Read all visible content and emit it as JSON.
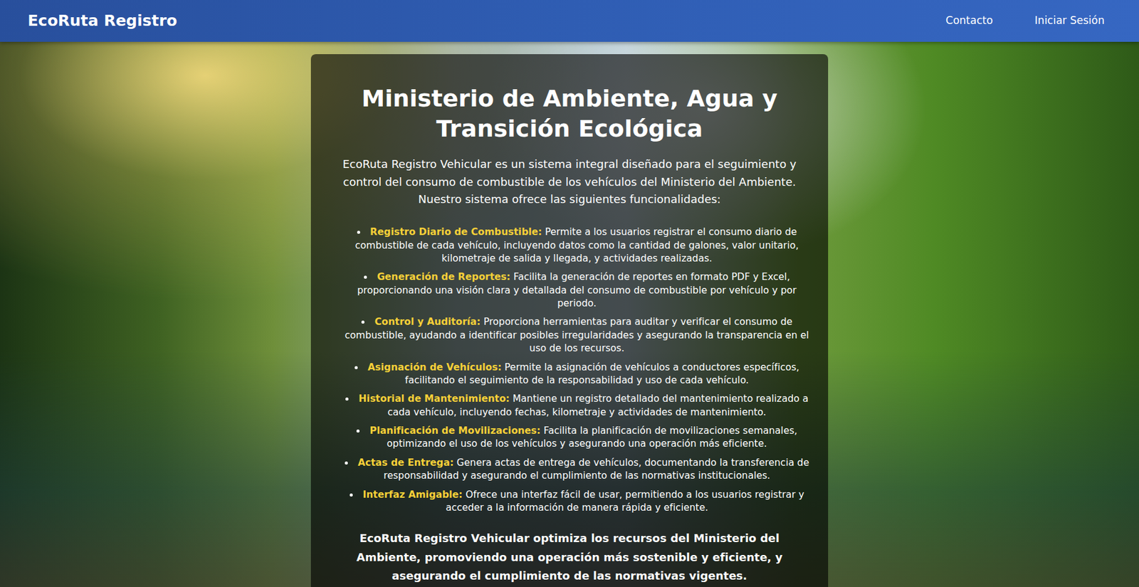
{
  "navbar": {
    "brand": "EcoRuta Registro",
    "links": [
      "Contacto",
      "Iniciar Sesión"
    ]
  },
  "panel": {
    "title": "Ministerio de Ambiente, Agua y Transición Ecológica",
    "intro": "EcoRuta Registro Vehicular es un sistema integral diseñado para el seguimiento y control del consumo de combustible de los vehículos del Ministerio del Ambiente. Nuestro sistema ofrece las siguientes funcionalidades:",
    "features": [
      {
        "label": "Registro Diario de Combustible:",
        "text": "Permite a los usuarios registrar el consumo diario de combustible de cada vehículo, incluyendo datos como la cantidad de galones, valor unitario, kilometraje de salida y llegada, y actividades realizadas."
      },
      {
        "label": "Generación de Reportes:",
        "text": "Facilita la generación de reportes en formato PDF y Excel, proporcionando una visión clara y detallada del consumo de combustible por vehículo y por periodo."
      },
      {
        "label": "Control y Auditoría:",
        "text": "Proporciona herramientas para auditar y verificar el consumo de combustible, ayudando a identificar posibles irregularidades y asegurando la transparencia en el uso de los recursos."
      },
      {
        "label": "Asignación de Vehículos:",
        "text": "Permite la asignación de vehículos a conductores específicos, facilitando el seguimiento de la responsabilidad y uso de cada vehículo."
      },
      {
        "label": "Historial de Mantenimiento:",
        "text": "Mantiene un registro detallado del mantenimiento realizado a cada vehículo, incluyendo fechas, kilometraje y actividades de mantenimiento."
      },
      {
        "label": "Planificación de Movilizaciones:",
        "text": "Facilita la planificación de movilizaciones semanales, optimizando el uso de los vehículos y asegurando una operación más eficiente."
      },
      {
        "label": "Actas de Entrega:",
        "text": "Genera actas de entrega de vehículos, documentando la transferencia de responsabilidad y asegurando el cumplimiento de las normativas institucionales."
      },
      {
        "label": "Interfaz Amigable:",
        "text": "Ofrece una interfaz fácil de usar, permitiendo a los usuarios registrar y acceder a la información de manera rápida y eficiente."
      }
    ],
    "closing": "EcoRuta Registro Vehicular optimiza los recursos del Ministerio del Ambiente, promoviendo una operación más sostenible y eficiente, y asegurando el cumplimiento de las normativas vigentes."
  }
}
